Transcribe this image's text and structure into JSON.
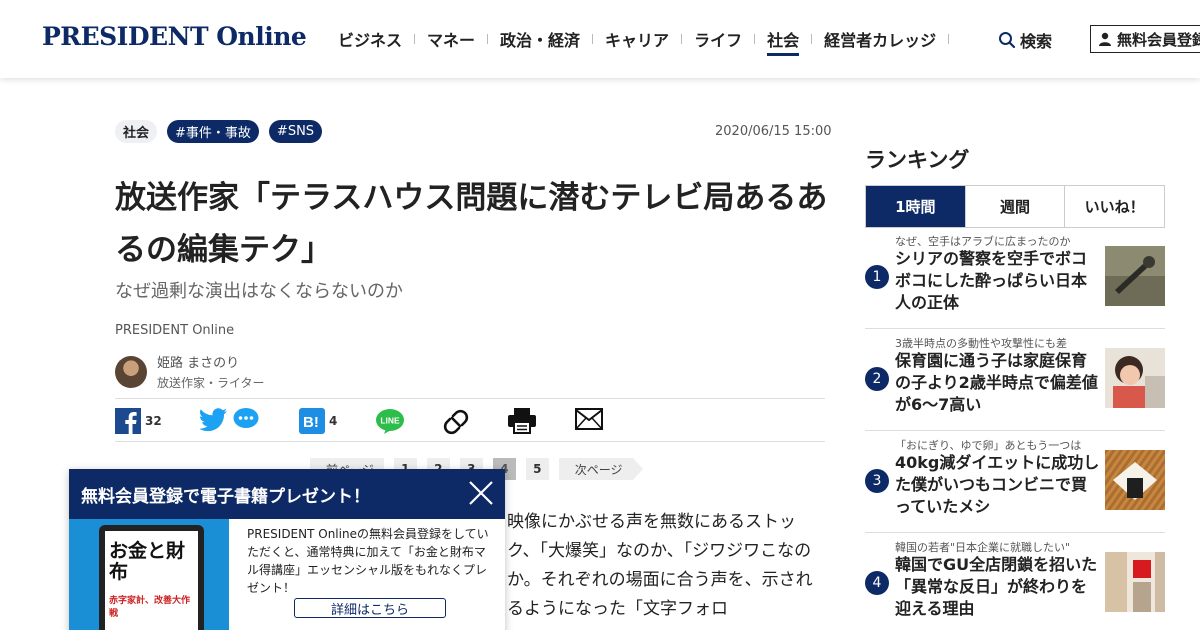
{
  "header": {
    "logo": "PRESIDENT Online",
    "nav": [
      "ビジネス",
      "マネー",
      "政治・経済",
      "キャリア",
      "ライフ",
      "社会",
      "経営者カレッジ"
    ],
    "active_nav": "社会",
    "search_label": "検索",
    "register_label": "無料会員登録"
  },
  "article": {
    "tags": [
      "社会",
      "#事件・事故",
      "#SNS"
    ],
    "date": "2020/06/15 15:00",
    "title": "放送作家「テラスハウス問題に潜むテレビ局あるあるの編集テク」",
    "subtitle": "なぜ過剰な演出はなくならないのか",
    "source": "PRESIDENT Online",
    "author_name": "姫路 まさのり",
    "author_role": "放送作家・ライター",
    "share": {
      "facebook_count": "32",
      "hatena_count": "4",
      "line_label": "LINE"
    },
    "pager": {
      "prev": "前ページ",
      "pages": [
        "1",
        "2",
        "3",
        "4",
        "5"
      ],
      "current": "4",
      "next": "次ページ"
    },
    "body": "映像にかぶせる声を無数にあるストック、「大爆笑」なのか、「ジワジワこなのか。それぞれの場面に合う声を、示されるようになった「文字フォロ"
  },
  "popup": {
    "title": "無料会員登録で電子書籍プレゼント！",
    "book_big": "お金と財布",
    "book_sub": "赤字家計、改善大作戦",
    "description": "PRESIDENT Onlineの無料会員登録をしていただくと、通常特典に加えて「お金と財布マル得講座」エッセンシャル版をもれなくプレゼント！",
    "button": "詳細はこちら"
  },
  "ranking": {
    "title": "ランキング",
    "tabs": [
      "1時間",
      "週間",
      "いいね！"
    ],
    "active_tab": "1時間",
    "items": [
      {
        "rank": "1",
        "kicker": "なぜ、空手はアラブに広まったのか",
        "headline": "シリアの警察を空手でボコボコにした酔っぱらい日本人の正体"
      },
      {
        "rank": "2",
        "kicker": "3歳半時点の多動性や攻撃性にも差",
        "headline": "保育園に通う子は家庭保育の子より2歳半時点で偏差値が6～7高い"
      },
      {
        "rank": "3",
        "kicker": "「おにぎり、ゆで卵」あともう一つは",
        "headline": "40kg減ダイエットに成功した僕がいつもコンビニで買っていたメシ"
      },
      {
        "rank": "4",
        "kicker": "韓国の若者\"日本企業に就職したい\"",
        "headline": "韓国でGU全店閉鎖を招いた「異常な反日」が終わりを迎える理由"
      }
    ]
  }
}
